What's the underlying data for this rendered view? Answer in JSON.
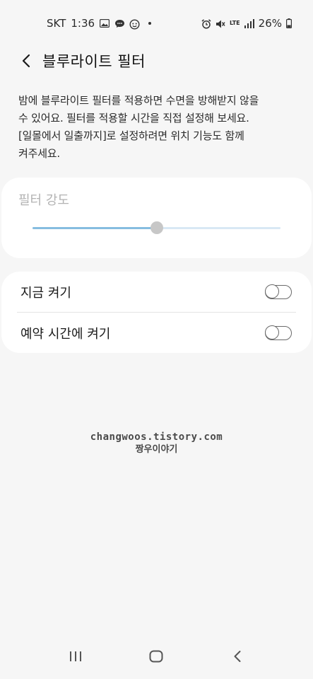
{
  "status_bar": {
    "carrier": "SKT",
    "time": "1:36",
    "network": "LTE",
    "battery": "26%",
    "left_icons": [
      "gallery-icon",
      "chat-icon",
      "face-icon",
      "dot-icon"
    ],
    "right_icons": [
      "alarm-icon",
      "mute-icon",
      "lte-icon",
      "signal-icon",
      "battery-icon"
    ]
  },
  "header": {
    "title": "블루라이트 필터"
  },
  "description": {
    "line1": "밤에 블루라이트 필터를 적용하면 수면을 방해받지 않을",
    "line2": "수 있어요. 필터를 적용할 시간을 직접 설정해 보세요.",
    "line3": "[일몰에서 일출까지]로 설정하려면 위치 기능도 함께",
    "line4": "켜주세요."
  },
  "intensity": {
    "label": "필터 강도",
    "value_fraction": 0.5,
    "fill_color": "#86bde0",
    "track_color": "#d8e8f4"
  },
  "toggles": [
    {
      "label": "지금 켜기",
      "on": false
    },
    {
      "label": "예약 시간에 켜기",
      "on": false
    }
  ],
  "watermark": {
    "url": "changwoos.tistory.com",
    "name": "짱우이야기"
  },
  "nav": {
    "icons": [
      "recents-icon",
      "home-icon",
      "back-icon"
    ]
  }
}
